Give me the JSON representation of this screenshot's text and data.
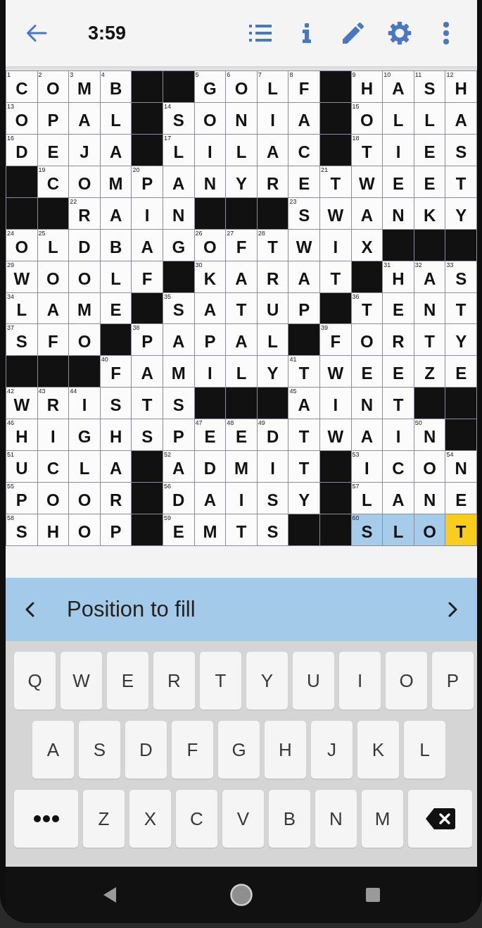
{
  "header": {
    "timer": "3:59"
  },
  "grid": {
    "rows": [
      [
        {
          "kind": "cell",
          "value": "C",
          "number": "1",
          "highlighted": false,
          "selected": false
        },
        {
          "kind": "cell",
          "value": "O",
          "number": "2",
          "highlighted": false,
          "selected": false
        },
        {
          "kind": "cell",
          "value": "M",
          "number": "3",
          "highlighted": false,
          "selected": false
        },
        {
          "kind": "cell",
          "value": "B",
          "number": "4",
          "highlighted": false,
          "selected": false
        },
        {
          "kind": "block"
        },
        {
          "kind": "block"
        },
        {
          "kind": "cell",
          "value": "G",
          "number": "5",
          "highlighted": false,
          "selected": false
        },
        {
          "kind": "cell",
          "value": "O",
          "number": "6",
          "highlighted": false,
          "selected": false
        },
        {
          "kind": "cell",
          "value": "L",
          "number": "7",
          "highlighted": false,
          "selected": false
        },
        {
          "kind": "cell",
          "value": "F",
          "number": "8",
          "highlighted": false,
          "selected": false
        },
        {
          "kind": "block"
        },
        {
          "kind": "cell",
          "value": "H",
          "number": "9",
          "highlighted": false,
          "selected": false
        },
        {
          "kind": "cell",
          "value": "A",
          "number": "10",
          "highlighted": false,
          "selected": false
        },
        {
          "kind": "cell",
          "value": "S",
          "number": "11",
          "highlighted": false,
          "selected": false
        },
        {
          "kind": "cell",
          "value": "H",
          "number": "12",
          "highlighted": false,
          "selected": false
        }
      ],
      [
        {
          "kind": "cell",
          "value": "O",
          "number": "13",
          "highlighted": false,
          "selected": false
        },
        {
          "kind": "cell",
          "value": "P",
          "highlighted": false,
          "selected": false
        },
        {
          "kind": "cell",
          "value": "A",
          "highlighted": false,
          "selected": false
        },
        {
          "kind": "cell",
          "value": "L",
          "highlighted": false,
          "selected": false
        },
        {
          "kind": "block"
        },
        {
          "kind": "cell",
          "value": "S",
          "number": "14",
          "highlighted": false,
          "selected": false
        },
        {
          "kind": "cell",
          "value": "O",
          "highlighted": false,
          "selected": false
        },
        {
          "kind": "cell",
          "value": "N",
          "highlighted": false,
          "selected": false
        },
        {
          "kind": "cell",
          "value": "I",
          "highlighted": false,
          "selected": false
        },
        {
          "kind": "cell",
          "value": "A",
          "highlighted": false,
          "selected": false
        },
        {
          "kind": "block"
        },
        {
          "kind": "cell",
          "value": "O",
          "number": "15",
          "highlighted": false,
          "selected": false
        },
        {
          "kind": "cell",
          "value": "L",
          "highlighted": false,
          "selected": false
        },
        {
          "kind": "cell",
          "value": "L",
          "highlighted": false,
          "selected": false
        },
        {
          "kind": "cell",
          "value": "A",
          "highlighted": false,
          "selected": false
        }
      ],
      [
        {
          "kind": "cell",
          "value": "D",
          "number": "16",
          "highlighted": false,
          "selected": false
        },
        {
          "kind": "cell",
          "value": "E",
          "highlighted": false,
          "selected": false
        },
        {
          "kind": "cell",
          "value": "J",
          "highlighted": false,
          "selected": false
        },
        {
          "kind": "cell",
          "value": "A",
          "highlighted": false,
          "selected": false
        },
        {
          "kind": "block"
        },
        {
          "kind": "cell",
          "value": "L",
          "number": "17",
          "highlighted": false,
          "selected": false
        },
        {
          "kind": "cell",
          "value": "I",
          "highlighted": false,
          "selected": false
        },
        {
          "kind": "cell",
          "value": "L",
          "highlighted": false,
          "selected": false
        },
        {
          "kind": "cell",
          "value": "A",
          "highlighted": false,
          "selected": false
        },
        {
          "kind": "cell",
          "value": "C",
          "highlighted": false,
          "selected": false
        },
        {
          "kind": "block"
        },
        {
          "kind": "cell",
          "value": "T",
          "number": "18",
          "highlighted": false,
          "selected": false
        },
        {
          "kind": "cell",
          "value": "I",
          "highlighted": false,
          "selected": false
        },
        {
          "kind": "cell",
          "value": "E",
          "highlighted": false,
          "selected": false
        },
        {
          "kind": "cell",
          "value": "S",
          "highlighted": false,
          "selected": false
        }
      ],
      [
        {
          "kind": "block"
        },
        {
          "kind": "cell",
          "value": "C",
          "number": "19",
          "highlighted": false,
          "selected": false
        },
        {
          "kind": "cell",
          "value": "O",
          "highlighted": false,
          "selected": false
        },
        {
          "kind": "cell",
          "value": "M",
          "highlighted": false,
          "selected": false
        },
        {
          "kind": "cell",
          "value": "P",
          "number": "20",
          "highlighted": false,
          "selected": false
        },
        {
          "kind": "cell",
          "value": "A",
          "highlighted": false,
          "selected": false
        },
        {
          "kind": "cell",
          "value": "N",
          "highlighted": false,
          "selected": false
        },
        {
          "kind": "cell",
          "value": "Y",
          "highlighted": false,
          "selected": false
        },
        {
          "kind": "cell",
          "value": "R",
          "highlighted": false,
          "selected": false
        },
        {
          "kind": "cell",
          "value": "E",
          "highlighted": false,
          "selected": false
        },
        {
          "kind": "cell",
          "value": "T",
          "number": "21",
          "highlighted": false,
          "selected": false
        },
        {
          "kind": "cell",
          "value": "W",
          "highlighted": false,
          "selected": false
        },
        {
          "kind": "cell",
          "value": "E",
          "highlighted": false,
          "selected": false
        },
        {
          "kind": "cell",
          "value": "E",
          "highlighted": false,
          "selected": false
        },
        {
          "kind": "cell",
          "value": "T",
          "highlighted": false,
          "selected": false
        }
      ],
      [
        {
          "kind": "block"
        },
        {
          "kind": "block"
        },
        {
          "kind": "cell",
          "value": "R",
          "number": "22",
          "highlighted": false,
          "selected": false
        },
        {
          "kind": "cell",
          "value": "A",
          "highlighted": false,
          "selected": false
        },
        {
          "kind": "cell",
          "value": "I",
          "highlighted": false,
          "selected": false
        },
        {
          "kind": "cell",
          "value": "N",
          "highlighted": false,
          "selected": false
        },
        {
          "kind": "block"
        },
        {
          "kind": "block"
        },
        {
          "kind": "block"
        },
        {
          "kind": "cell",
          "value": "S",
          "number": "23",
          "highlighted": false,
          "selected": false
        },
        {
          "kind": "cell",
          "value": "W",
          "highlighted": false,
          "selected": false
        },
        {
          "kind": "cell",
          "value": "A",
          "highlighted": false,
          "selected": false
        },
        {
          "kind": "cell",
          "value": "N",
          "highlighted": false,
          "selected": false
        },
        {
          "kind": "cell",
          "value": "K",
          "highlighted": false,
          "selected": false
        },
        {
          "kind": "cell",
          "value": "Y",
          "highlighted": false,
          "selected": false
        }
      ],
      [
        {
          "kind": "cell",
          "value": "O",
          "number": "24",
          "highlighted": false,
          "selected": false
        },
        {
          "kind": "cell",
          "value": "L",
          "number": "25",
          "highlighted": false,
          "selected": false
        },
        {
          "kind": "cell",
          "value": "D",
          "highlighted": false,
          "selected": false
        },
        {
          "kind": "cell",
          "value": "B",
          "highlighted": false,
          "selected": false
        },
        {
          "kind": "cell",
          "value": "A",
          "highlighted": false,
          "selected": false
        },
        {
          "kind": "cell",
          "value": "G",
          "highlighted": false,
          "selected": false
        },
        {
          "kind": "cell",
          "value": "O",
          "number": "26",
          "highlighted": false,
          "selected": false
        },
        {
          "kind": "cell",
          "value": "F",
          "number": "27",
          "highlighted": false,
          "selected": false
        },
        {
          "kind": "cell",
          "value": "T",
          "number": "28",
          "highlighted": false,
          "selected": false
        },
        {
          "kind": "cell",
          "value": "W",
          "highlighted": false,
          "selected": false
        },
        {
          "kind": "cell",
          "value": "I",
          "highlighted": false,
          "selected": false
        },
        {
          "kind": "cell",
          "value": "X",
          "highlighted": false,
          "selected": false
        },
        {
          "kind": "block"
        },
        {
          "kind": "block"
        },
        {
          "kind": "block"
        }
      ],
      [
        {
          "kind": "cell",
          "value": "W",
          "number": "29",
          "highlighted": false,
          "selected": false
        },
        {
          "kind": "cell",
          "value": "O",
          "highlighted": false,
          "selected": false
        },
        {
          "kind": "cell",
          "value": "O",
          "highlighted": false,
          "selected": false
        },
        {
          "kind": "cell",
          "value": "L",
          "highlighted": false,
          "selected": false
        },
        {
          "kind": "cell",
          "value": "F",
          "highlighted": false,
          "selected": false
        },
        {
          "kind": "block"
        },
        {
          "kind": "cell",
          "value": "K",
          "number": "30",
          "highlighted": false,
          "selected": false
        },
        {
          "kind": "cell",
          "value": "A",
          "highlighted": false,
          "selected": false
        },
        {
          "kind": "cell",
          "value": "R",
          "highlighted": false,
          "selected": false
        },
        {
          "kind": "cell",
          "value": "A",
          "highlighted": false,
          "selected": false
        },
        {
          "kind": "cell",
          "value": "T",
          "highlighted": false,
          "selected": false
        },
        {
          "kind": "block"
        },
        {
          "kind": "cell",
          "value": "H",
          "number": "31",
          "highlighted": false,
          "selected": false
        },
        {
          "kind": "cell",
          "value": "A",
          "number": "32",
          "highlighted": false,
          "selected": false
        },
        {
          "kind": "cell",
          "value": "S",
          "number": "33",
          "highlighted": false,
          "selected": false
        }
      ],
      [
        {
          "kind": "cell",
          "value": "L",
          "number": "34",
          "highlighted": false,
          "selected": false
        },
        {
          "kind": "cell",
          "value": "A",
          "highlighted": false,
          "selected": false
        },
        {
          "kind": "cell",
          "value": "M",
          "highlighted": false,
          "selected": false
        },
        {
          "kind": "cell",
          "value": "E",
          "highlighted": false,
          "selected": false
        },
        {
          "kind": "block"
        },
        {
          "kind": "cell",
          "value": "S",
          "number": "35",
          "highlighted": false,
          "selected": false
        },
        {
          "kind": "cell",
          "value": "A",
          "highlighted": false,
          "selected": false
        },
        {
          "kind": "cell",
          "value": "T",
          "highlighted": false,
          "selected": false
        },
        {
          "kind": "cell",
          "value": "U",
          "highlighted": false,
          "selected": false
        },
        {
          "kind": "cell",
          "value": "P",
          "highlighted": false,
          "selected": false
        },
        {
          "kind": "block"
        },
        {
          "kind": "cell",
          "value": "T",
          "number": "36",
          "highlighted": false,
          "selected": false
        },
        {
          "kind": "cell",
          "value": "E",
          "highlighted": false,
          "selected": false
        },
        {
          "kind": "cell",
          "value": "N",
          "highlighted": false,
          "selected": false
        },
        {
          "kind": "cell",
          "value": "T",
          "highlighted": false,
          "selected": false
        }
      ],
      [
        {
          "kind": "cell",
          "value": "S",
          "number": "37",
          "highlighted": false,
          "selected": false
        },
        {
          "kind": "cell",
          "value": "F",
          "highlighted": false,
          "selected": false
        },
        {
          "kind": "cell",
          "value": "O",
          "highlighted": false,
          "selected": false
        },
        {
          "kind": "block"
        },
        {
          "kind": "cell",
          "value": "P",
          "number": "38",
          "highlighted": false,
          "selected": false
        },
        {
          "kind": "cell",
          "value": "A",
          "highlighted": false,
          "selected": false
        },
        {
          "kind": "cell",
          "value": "P",
          "highlighted": false,
          "selected": false
        },
        {
          "kind": "cell",
          "value": "A",
          "highlighted": false,
          "selected": false
        },
        {
          "kind": "cell",
          "value": "L",
          "highlighted": false,
          "selected": false
        },
        {
          "kind": "block"
        },
        {
          "kind": "cell",
          "value": "F",
          "number": "39",
          "highlighted": false,
          "selected": false
        },
        {
          "kind": "cell",
          "value": "O",
          "highlighted": false,
          "selected": false
        },
        {
          "kind": "cell",
          "value": "R",
          "highlighted": false,
          "selected": false
        },
        {
          "kind": "cell",
          "value": "T",
          "highlighted": false,
          "selected": false
        },
        {
          "kind": "cell",
          "value": "Y",
          "highlighted": false,
          "selected": false
        }
      ],
      [
        {
          "kind": "block"
        },
        {
          "kind": "block"
        },
        {
          "kind": "block"
        },
        {
          "kind": "cell",
          "value": "F",
          "number": "40",
          "highlighted": false,
          "selected": false
        },
        {
          "kind": "cell",
          "value": "A",
          "highlighted": false,
          "selected": false
        },
        {
          "kind": "cell",
          "value": "M",
          "highlighted": false,
          "selected": false
        },
        {
          "kind": "cell",
          "value": "I",
          "highlighted": false,
          "selected": false
        },
        {
          "kind": "cell",
          "value": "L",
          "highlighted": false,
          "selected": false
        },
        {
          "kind": "cell",
          "value": "Y",
          "highlighted": false,
          "selected": false
        },
        {
          "kind": "cell",
          "value": "T",
          "number": "41",
          "highlighted": false,
          "selected": false
        },
        {
          "kind": "cell",
          "value": "W",
          "highlighted": false,
          "selected": false
        },
        {
          "kind": "cell",
          "value": "E",
          "highlighted": false,
          "selected": false
        },
        {
          "kind": "cell",
          "value": "E",
          "highlighted": false,
          "selected": false
        },
        {
          "kind": "cell",
          "value": "Z",
          "highlighted": false,
          "selected": false
        },
        {
          "kind": "cell",
          "value": "E",
          "highlighted": false,
          "selected": false
        }
      ],
      [
        {
          "kind": "cell",
          "value": "W",
          "number": "42",
          "highlighted": false,
          "selected": false
        },
        {
          "kind": "cell",
          "value": "R",
          "number": "43",
          "highlighted": false,
          "selected": false
        },
        {
          "kind": "cell",
          "value": "I",
          "number": "44",
          "highlighted": false,
          "selected": false
        },
        {
          "kind": "cell",
          "value": "S",
          "highlighted": false,
          "selected": false
        },
        {
          "kind": "cell",
          "value": "T",
          "highlighted": false,
          "selected": false
        },
        {
          "kind": "cell",
          "value": "S",
          "highlighted": false,
          "selected": false
        },
        {
          "kind": "block"
        },
        {
          "kind": "block"
        },
        {
          "kind": "block"
        },
        {
          "kind": "cell",
          "value": "A",
          "number": "45",
          "highlighted": false,
          "selected": false
        },
        {
          "kind": "cell",
          "value": "I",
          "highlighted": false,
          "selected": false
        },
        {
          "kind": "cell",
          "value": "N",
          "highlighted": false,
          "selected": false
        },
        {
          "kind": "cell",
          "value": "T",
          "highlighted": false,
          "selected": false
        },
        {
          "kind": "block"
        },
        {
          "kind": "block"
        }
      ],
      [
        {
          "kind": "cell",
          "value": "H",
          "number": "46",
          "highlighted": false,
          "selected": false
        },
        {
          "kind": "cell",
          "value": "I",
          "highlighted": false,
          "selected": false
        },
        {
          "kind": "cell",
          "value": "G",
          "highlighted": false,
          "selected": false
        },
        {
          "kind": "cell",
          "value": "H",
          "highlighted": false,
          "selected": false
        },
        {
          "kind": "cell",
          "value": "S",
          "highlighted": false,
          "selected": false
        },
        {
          "kind": "cell",
          "value": "P",
          "highlighted": false,
          "selected": false
        },
        {
          "kind": "cell",
          "value": "E",
          "number": "47",
          "highlighted": false,
          "selected": false
        },
        {
          "kind": "cell",
          "value": "E",
          "number": "48",
          "highlighted": false,
          "selected": false
        },
        {
          "kind": "cell",
          "value": "D",
          "number": "49",
          "highlighted": false,
          "selected": false
        },
        {
          "kind": "cell",
          "value": "T",
          "highlighted": false,
          "selected": false
        },
        {
          "kind": "cell",
          "value": "W",
          "highlighted": false,
          "selected": false
        },
        {
          "kind": "cell",
          "value": "A",
          "highlighted": false,
          "selected": false
        },
        {
          "kind": "cell",
          "value": "I",
          "highlighted": false,
          "selected": false
        },
        {
          "kind": "cell",
          "value": "N",
          "number": "50",
          "highlighted": false,
          "selected": false
        },
        {
          "kind": "block"
        }
      ],
      [
        {
          "kind": "cell",
          "value": "U",
          "number": "51",
          "highlighted": false,
          "selected": false
        },
        {
          "kind": "cell",
          "value": "C",
          "highlighted": false,
          "selected": false
        },
        {
          "kind": "cell",
          "value": "L",
          "highlighted": false,
          "selected": false
        },
        {
          "kind": "cell",
          "value": "A",
          "highlighted": false,
          "selected": false
        },
        {
          "kind": "block"
        },
        {
          "kind": "cell",
          "value": "A",
          "number": "52",
          "highlighted": false,
          "selected": false
        },
        {
          "kind": "cell",
          "value": "D",
          "highlighted": false,
          "selected": false
        },
        {
          "kind": "cell",
          "value": "M",
          "highlighted": false,
          "selected": false
        },
        {
          "kind": "cell",
          "value": "I",
          "highlighted": false,
          "selected": false
        },
        {
          "kind": "cell",
          "value": "T",
          "highlighted": false,
          "selected": false
        },
        {
          "kind": "block"
        },
        {
          "kind": "cell",
          "value": "I",
          "number": "53",
          "highlighted": false,
          "selected": false
        },
        {
          "kind": "cell",
          "value": "C",
          "highlighted": false,
          "selected": false
        },
        {
          "kind": "cell",
          "value": "O",
          "highlighted": false,
          "selected": false
        },
        {
          "kind": "cell",
          "value": "N",
          "number": "54",
          "highlighted": false,
          "selected": false
        }
      ],
      [
        {
          "kind": "cell",
          "value": "P",
          "number": "55",
          "highlighted": false,
          "selected": false
        },
        {
          "kind": "cell",
          "value": "O",
          "highlighted": false,
          "selected": false
        },
        {
          "kind": "cell",
          "value": "O",
          "highlighted": false,
          "selected": false
        },
        {
          "kind": "cell",
          "value": "R",
          "highlighted": false,
          "selected": false
        },
        {
          "kind": "block"
        },
        {
          "kind": "cell",
          "value": "D",
          "number": "56",
          "highlighted": false,
          "selected": false
        },
        {
          "kind": "cell",
          "value": "A",
          "highlighted": false,
          "selected": false
        },
        {
          "kind": "cell",
          "value": "I",
          "highlighted": false,
          "selected": false
        },
        {
          "kind": "cell",
          "value": "S",
          "highlighted": false,
          "selected": false
        },
        {
          "kind": "cell",
          "value": "Y",
          "highlighted": false,
          "selected": false
        },
        {
          "kind": "block"
        },
        {
          "kind": "cell",
          "value": "L",
          "number": "57",
          "highlighted": false,
          "selected": false
        },
        {
          "kind": "cell",
          "value": "A",
          "highlighted": false,
          "selected": false
        },
        {
          "kind": "cell",
          "value": "N",
          "highlighted": false,
          "selected": false
        },
        {
          "kind": "cell",
          "value": "E",
          "highlighted": false,
          "selected": false
        }
      ],
      [
        {
          "kind": "cell",
          "value": "S",
          "number": "58",
          "highlighted": false,
          "selected": false
        },
        {
          "kind": "cell",
          "value": "H",
          "highlighted": false,
          "selected": false
        },
        {
          "kind": "cell",
          "value": "O",
          "highlighted": false,
          "selected": false
        },
        {
          "kind": "cell",
          "value": "P",
          "highlighted": false,
          "selected": false
        },
        {
          "kind": "block"
        },
        {
          "kind": "cell",
          "value": "E",
          "number": "59",
          "highlighted": false,
          "selected": false
        },
        {
          "kind": "cell",
          "value": "M",
          "highlighted": false,
          "selected": false
        },
        {
          "kind": "cell",
          "value": "T",
          "highlighted": false,
          "selected": false
        },
        {
          "kind": "cell",
          "value": "S",
          "highlighted": false,
          "selected": false
        },
        {
          "kind": "block"
        },
        {
          "kind": "block"
        },
        {
          "kind": "cell",
          "value": "S",
          "number": "60",
          "highlighted": true,
          "selected": false
        },
        {
          "kind": "cell",
          "value": "L",
          "highlighted": true,
          "selected": false
        },
        {
          "kind": "cell",
          "value": "O",
          "highlighted": true,
          "selected": false
        },
        {
          "kind": "cell",
          "value": "T",
          "highlighted": true,
          "selected": true
        }
      ]
    ]
  },
  "clue_bar": {
    "clue": "Position to fill"
  },
  "keyboard": {
    "rows": [
      [
        {
          "kind": "letter",
          "label": "Q"
        },
        {
          "kind": "letter",
          "label": "W"
        },
        {
          "kind": "letter",
          "label": "E"
        },
        {
          "kind": "letter",
          "label": "R"
        },
        {
          "kind": "letter",
          "label": "T"
        },
        {
          "kind": "letter",
          "label": "Y"
        },
        {
          "kind": "letter",
          "label": "U"
        },
        {
          "kind": "letter",
          "label": "I"
        },
        {
          "kind": "letter",
          "label": "O"
        },
        {
          "kind": "letter",
          "label": "P"
        }
      ],
      [
        {
          "kind": "letter",
          "label": "A"
        },
        {
          "kind": "letter",
          "label": "S"
        },
        {
          "kind": "letter",
          "label": "D"
        },
        {
          "kind": "letter",
          "label": "F"
        },
        {
          "kind": "letter",
          "label": "G"
        },
        {
          "kind": "letter",
          "label": "H"
        },
        {
          "kind": "letter",
          "label": "J"
        },
        {
          "kind": "letter",
          "label": "K"
        },
        {
          "kind": "letter",
          "label": "L"
        }
      ],
      [
        {
          "kind": "more"
        },
        {
          "kind": "letter",
          "label": "Z"
        },
        {
          "kind": "letter",
          "label": "X"
        },
        {
          "kind": "letter",
          "label": "C"
        },
        {
          "kind": "letter",
          "label": "V"
        },
        {
          "kind": "letter",
          "label": "B"
        },
        {
          "kind": "letter",
          "label": "N"
        },
        {
          "kind": "letter",
          "label": "M"
        },
        {
          "kind": "backspace"
        }
      ]
    ]
  }
}
